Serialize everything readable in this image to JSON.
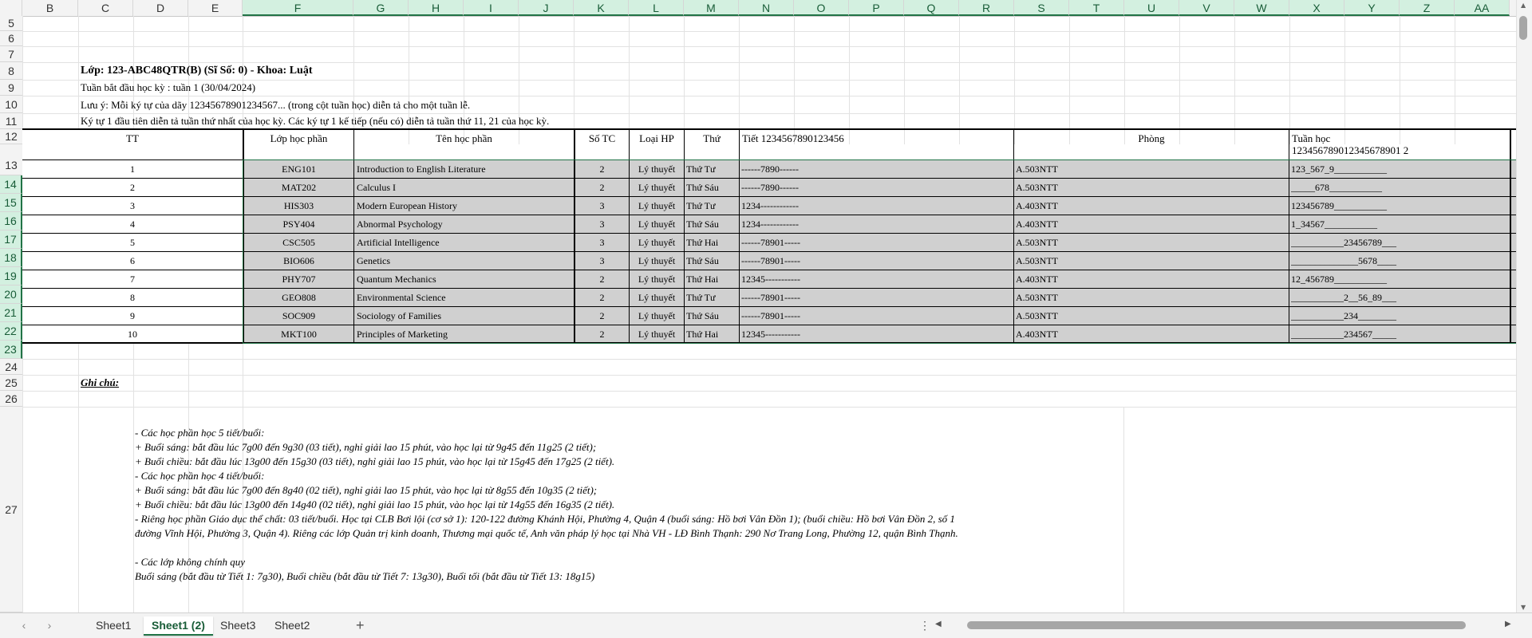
{
  "columns": [
    "B",
    "C",
    "D",
    "E",
    "F",
    "G",
    "H",
    "I",
    "J",
    "K",
    "L",
    "M",
    "N",
    "O",
    "P",
    "Q",
    "R",
    "S",
    "T",
    "U",
    "V",
    "W",
    "X",
    "Y",
    "Z",
    "AA"
  ],
  "rows": [
    "5",
    "6",
    "7",
    "8",
    "9",
    "10",
    "11",
    "12",
    "13",
    "14",
    "15",
    "16",
    "17",
    "18",
    "19",
    "20",
    "21",
    "22",
    "23",
    "24",
    "25",
    "26",
    "27"
  ],
  "header": {
    "title": "Lớp: 123-ABC48QTR(B) (Sĩ Số: 0) - Khoa: Luật",
    "line1": "Tuần bắt đầu học kỳ : tuần 1 (30/04/2024)",
    "line2": "Lưu ý: Mỗi ký tự của dãy 12345678901234567... (trong cột tuần học) diễn tả cho một tuần lễ.",
    "line3": "Ký tự 1 đầu tiên diễn tả tuần thứ nhất của học kỳ. Các ký tự 1 kế tiếp (nếu có) diễn tả tuần thứ 11, 21 của học kỳ."
  },
  "table": {
    "headers": {
      "tt": "TT",
      "lop": "Lớp học phần",
      "ten": "Tên học phần",
      "sotc": "Số TC",
      "loai": "Loại HP",
      "thu": "Thứ",
      "tiet": "Tiết 1234567890123456",
      "phong": "Phòng",
      "tuan1": "Tuần học",
      "tuan2": "123456789012345678901 2"
    },
    "rows": [
      {
        "tt": "1",
        "lop": "ENG101",
        "ten": "Introduction to English Literature",
        "tc": "2",
        "loai": "Lý thuyết",
        "thu": "Thứ Tư",
        "tiet": "------7890------",
        "phong": "A.503NTT",
        "tuan": "123_567_9___________"
      },
      {
        "tt": "2",
        "lop": "MAT202",
        "ten": "Calculus I",
        "tc": "2",
        "loai": "Lý thuyết",
        "thu": "Thứ Sáu",
        "tiet": "------7890------",
        "phong": "A.503NTT",
        "tuan": "_____678___________"
      },
      {
        "tt": "3",
        "lop": "HIS303",
        "ten": "Modern European History",
        "tc": "3",
        "loai": "Lý thuyết",
        "thu": "Thứ Tư",
        "tiet": "1234------------",
        "phong": "A.403NTT",
        "tuan": "123456789___________"
      },
      {
        "tt": "4",
        "lop": "PSY404",
        "ten": "Abnormal Psychology",
        "tc": "3",
        "loai": "Lý thuyết",
        "thu": "Thứ Sáu",
        "tiet": "1234------------",
        "phong": "A.403NTT",
        "tuan": "1_34567___________"
      },
      {
        "tt": "5",
        "lop": "CSC505",
        "ten": "Artificial Intelligence",
        "tc": "3",
        "loai": "Lý thuyết",
        "thu": "Thứ Hai",
        "tiet": "------78901-----",
        "phong": "A.503NTT",
        "tuan": "___________23456789___"
      },
      {
        "tt": "6",
        "lop": "BIO606",
        "ten": "Genetics",
        "tc": "3",
        "loai": "Lý thuyết",
        "thu": "Thứ Sáu",
        "tiet": "------78901-----",
        "phong": "A.503NTT",
        "tuan": "______________5678____"
      },
      {
        "tt": "7",
        "lop": "PHY707",
        "ten": "Quantum Mechanics",
        "tc": "2",
        "loai": "Lý thuyết",
        "thu": "Thứ Hai",
        "tiet": "12345-----------",
        "phong": "A.403NTT",
        "tuan": "12_456789___________"
      },
      {
        "tt": "8",
        "lop": "GEO808",
        "ten": "Environmental Science",
        "tc": "2",
        "loai": "Lý thuyết",
        "thu": "Thứ Tư",
        "tiet": "------78901-----",
        "phong": "A.503NTT",
        "tuan": "___________2__56_89___"
      },
      {
        "tt": "9",
        "lop": "SOC909",
        "ten": "Sociology of Families",
        "tc": "2",
        "loai": "Lý thuyết",
        "thu": "Thứ Sáu",
        "tiet": "------78901-----",
        "phong": "A.503NTT",
        "tuan": "___________234________"
      },
      {
        "tt": "10",
        "lop": "MKT100",
        "ten": "Principles of Marketing",
        "tc": "2",
        "loai": "Lý thuyết",
        "thu": "Thứ Hai",
        "tiet": "12345-----------",
        "phong": "A.403NTT",
        "tuan": "___________234567_____"
      }
    ]
  },
  "notes": {
    "title": "Ghi chú:",
    "lines": [
      "- Các học phần học 5 tiết/buổi:",
      "+ Buổi sáng: bắt đầu lúc 7g00 đến 9g30 (03 tiết), nghỉ giải lao 15 phút, vào học lại từ 9g45 đến 11g25 (2 tiết);",
      "+ Buổi chiều: bắt đầu lúc 13g00 đến 15g30 (03 tiết), nghỉ giải lao 15 phút, vào học lại từ 15g45 đến 17g25 (2 tiết).",
      "- Các học phần học 4 tiết/buổi:",
      "+ Buổi sáng: bắt đầu lúc 7g00 đến 8g40 (02 tiết), nghỉ giải lao 15 phút, vào học lại từ 8g55 đến 10g35 (2 tiết);",
      "+ Buổi chiều: bắt đầu lúc 13g00 đến 14g40 (02 tiết), nghỉ giải lao 15 phút, vào học lại từ 14g55 đến 16g35 (2 tiết).",
      "- Riêng học phần Giáo dục thể chất: 03 tiết/buổi. Học tại CLB Bơi lội (cơ sở 1): 120-122 đường Khánh Hội, Phường 4, Quận 4 (buổi sáng: Hồ bơi Vân Đồn 1); (buổi chiều: Hồ bơi Vân Đồn 2, số 1",
      "đường Vĩnh Hội, Phường 3, Quận 4). Riêng các lớp Quản trị kinh doanh, Thương mại quốc tế, Anh văn pháp lý học tại Nhà VH - LĐ Bình Thạnh: 290 Nơ Trang Long, Phường 12, quận Bình Thạnh.",
      "",
      "- Các lớp không chính quy",
      "Buổi sáng (bắt đầu từ Tiết 1: 7g30), Buổi chiều (bắt đầu từ Tiết 7: 13g30), Buổi tối (bắt đầu từ Tiết 13: 18g15)"
    ]
  },
  "tabs": {
    "prev": "‹",
    "next": "›",
    "sheet1": "Sheet1",
    "sheet1_2": "Sheet1 (2)",
    "sheet3": "Sheet3",
    "sheet2": "Sheet2",
    "add": "+",
    "more": "⋮"
  }
}
